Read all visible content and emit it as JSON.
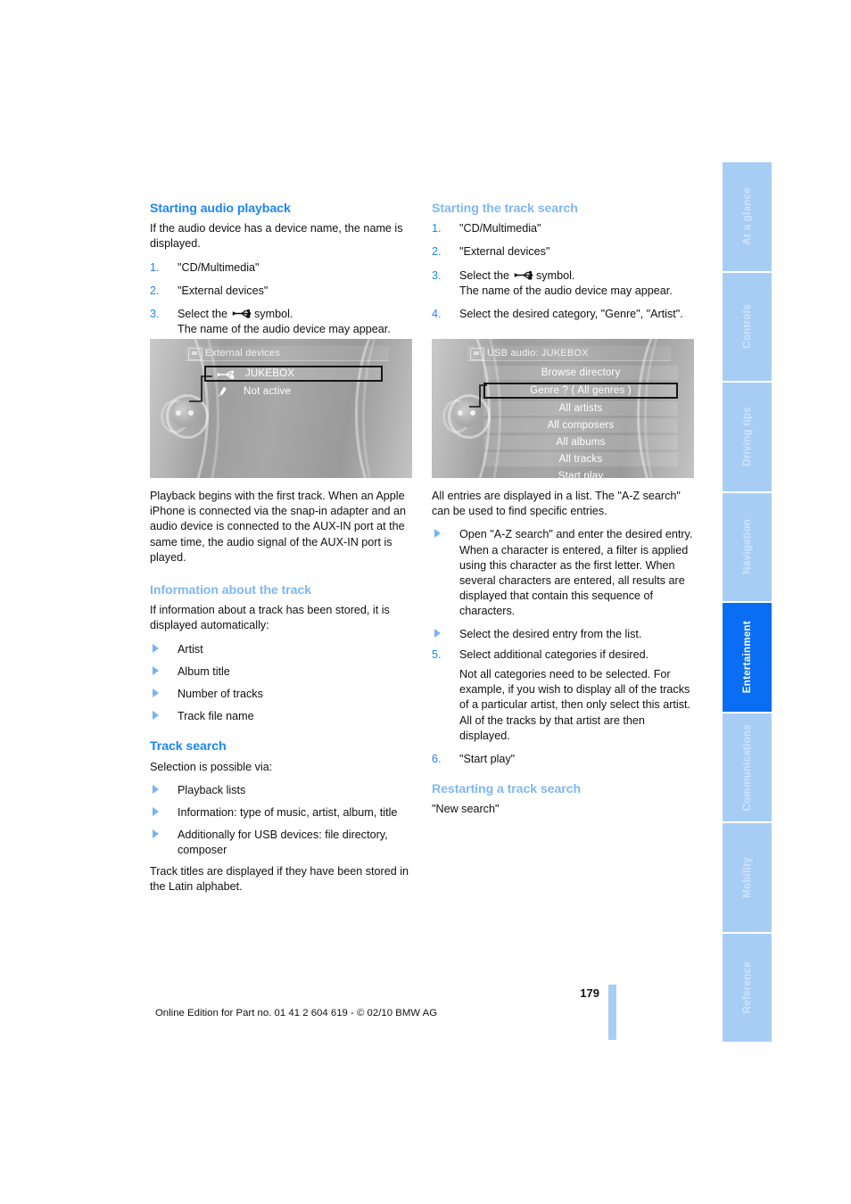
{
  "page": {
    "number": "179",
    "footer_text": "Online Edition for Part no. 01 41 2 604 619 - © 02/10 BMW AG",
    "accent_blue": "#1E86F0",
    "tab_blue": "#A8CDF5",
    "tab_active_blue": "#0A6EF5"
  },
  "tabs": [
    {
      "label": "At a glance",
      "active": false
    },
    {
      "label": "Controls",
      "active": false
    },
    {
      "label": "Driving tips",
      "active": false
    },
    {
      "label": "Navigation",
      "active": false
    },
    {
      "label": "Entertainment",
      "active": true
    },
    {
      "label": "Communications",
      "active": false
    },
    {
      "label": "Mobility",
      "active": false
    },
    {
      "label": "Reference",
      "active": false
    }
  ],
  "left_column": {
    "heading_1": "Starting audio playback",
    "intro_1": "If the audio device has a device name, the name is displayed.",
    "steps": [
      {
        "num": "1.",
        "text": "\"CD/Multimedia\"",
        "sub": ""
      },
      {
        "num": "2.",
        "text": "\"External devices\"",
        "sub": ""
      },
      {
        "num": "3.",
        "text_before_icon": "Select the ",
        "text_after_icon": " symbol.",
        "sub": "The name of the audio device may appear."
      }
    ],
    "after_figure": "Playback begins with the first track. When an Apple iPhone is connected via the snap-in adapter and an audio device is connected to the AUX-IN port at the same time, the audio signal of the AUX-IN port is played.",
    "heading_2": "Information about the track",
    "intro_2": "If information about a track has been stored, it is displayed automatically:",
    "track_info_items": [
      "Artist",
      "Album title",
      "Number of tracks",
      "Track file name"
    ],
    "heading_3": "Track search",
    "intro_3": "Selection is possible via:",
    "track_search_items": [
      "Playback lists",
      "Information: type of music, artist, album, title",
      "Additionally for USB devices: file directory, composer"
    ],
    "outro_3": "Track titles are displayed if they have been stored in the Latin alphabet."
  },
  "right_column": {
    "heading_1": "Starting the track search",
    "steps": [
      {
        "num": "1.",
        "text": "\"CD/Multimedia\"",
        "sub": ""
      },
      {
        "num": "2.",
        "text": "\"External devices\"",
        "sub": ""
      },
      {
        "num": "3.",
        "text_before_icon": "Select the ",
        "text_after_icon": " symbol.",
        "sub": "The name of the audio device may appear."
      },
      {
        "num": "4.",
        "text": "Select the desired category, \"Genre\", \"Artist\".",
        "sub": ""
      }
    ],
    "after_figure": "All entries are displayed in a list. The \"A-Z search\" can be used to find specific entries.",
    "bullets": [
      "Open \"A-Z search\" and enter the desired entry. When a character is entered, a filter is applied using this character as the first letter. When several characters are entered, all results are displayed that contain this sequence of characters.",
      "Select the desired entry from the list."
    ],
    "step_5_num": "5.",
    "step_5_text": "Select additional categories if desired.",
    "step_5_sub": "Not all categories need to be selected. For example, if you wish to display all of the tracks of a particular artist, then only select this artist. All of the tracks by that artist are then displayed.",
    "step_6_num": "6.",
    "step_6_text": "\"Start play\"",
    "heading_2": "Restarting a track search",
    "outro_2": "\"New search\""
  },
  "figure_left": {
    "title": "External devices",
    "title_icon": "multimedia-icon",
    "rows": [
      {
        "label": "JUKEBOX",
        "icon": "usb-icon",
        "selected": true
      },
      {
        "label": "Not active",
        "icon": "aux-plug-icon",
        "selected": false
      }
    ]
  },
  "figure_right": {
    "title": "USB audio: JUKEBOX",
    "title_icon": "multimedia-icon",
    "rows": [
      {
        "label": "Browse directory",
        "selected": false,
        "plate": true
      },
      {
        "label": "Genre ? ( All genres )",
        "selected": true,
        "plate": true
      },
      {
        "label": "All artists",
        "selected": false,
        "plate": true
      },
      {
        "label": "All composers",
        "selected": false,
        "plate": true
      },
      {
        "label": "All albums",
        "selected": false,
        "plate": true
      },
      {
        "label": "All tracks",
        "selected": false,
        "plate": true
      },
      {
        "label": "Start play",
        "selected": false,
        "plate": false
      }
    ]
  }
}
